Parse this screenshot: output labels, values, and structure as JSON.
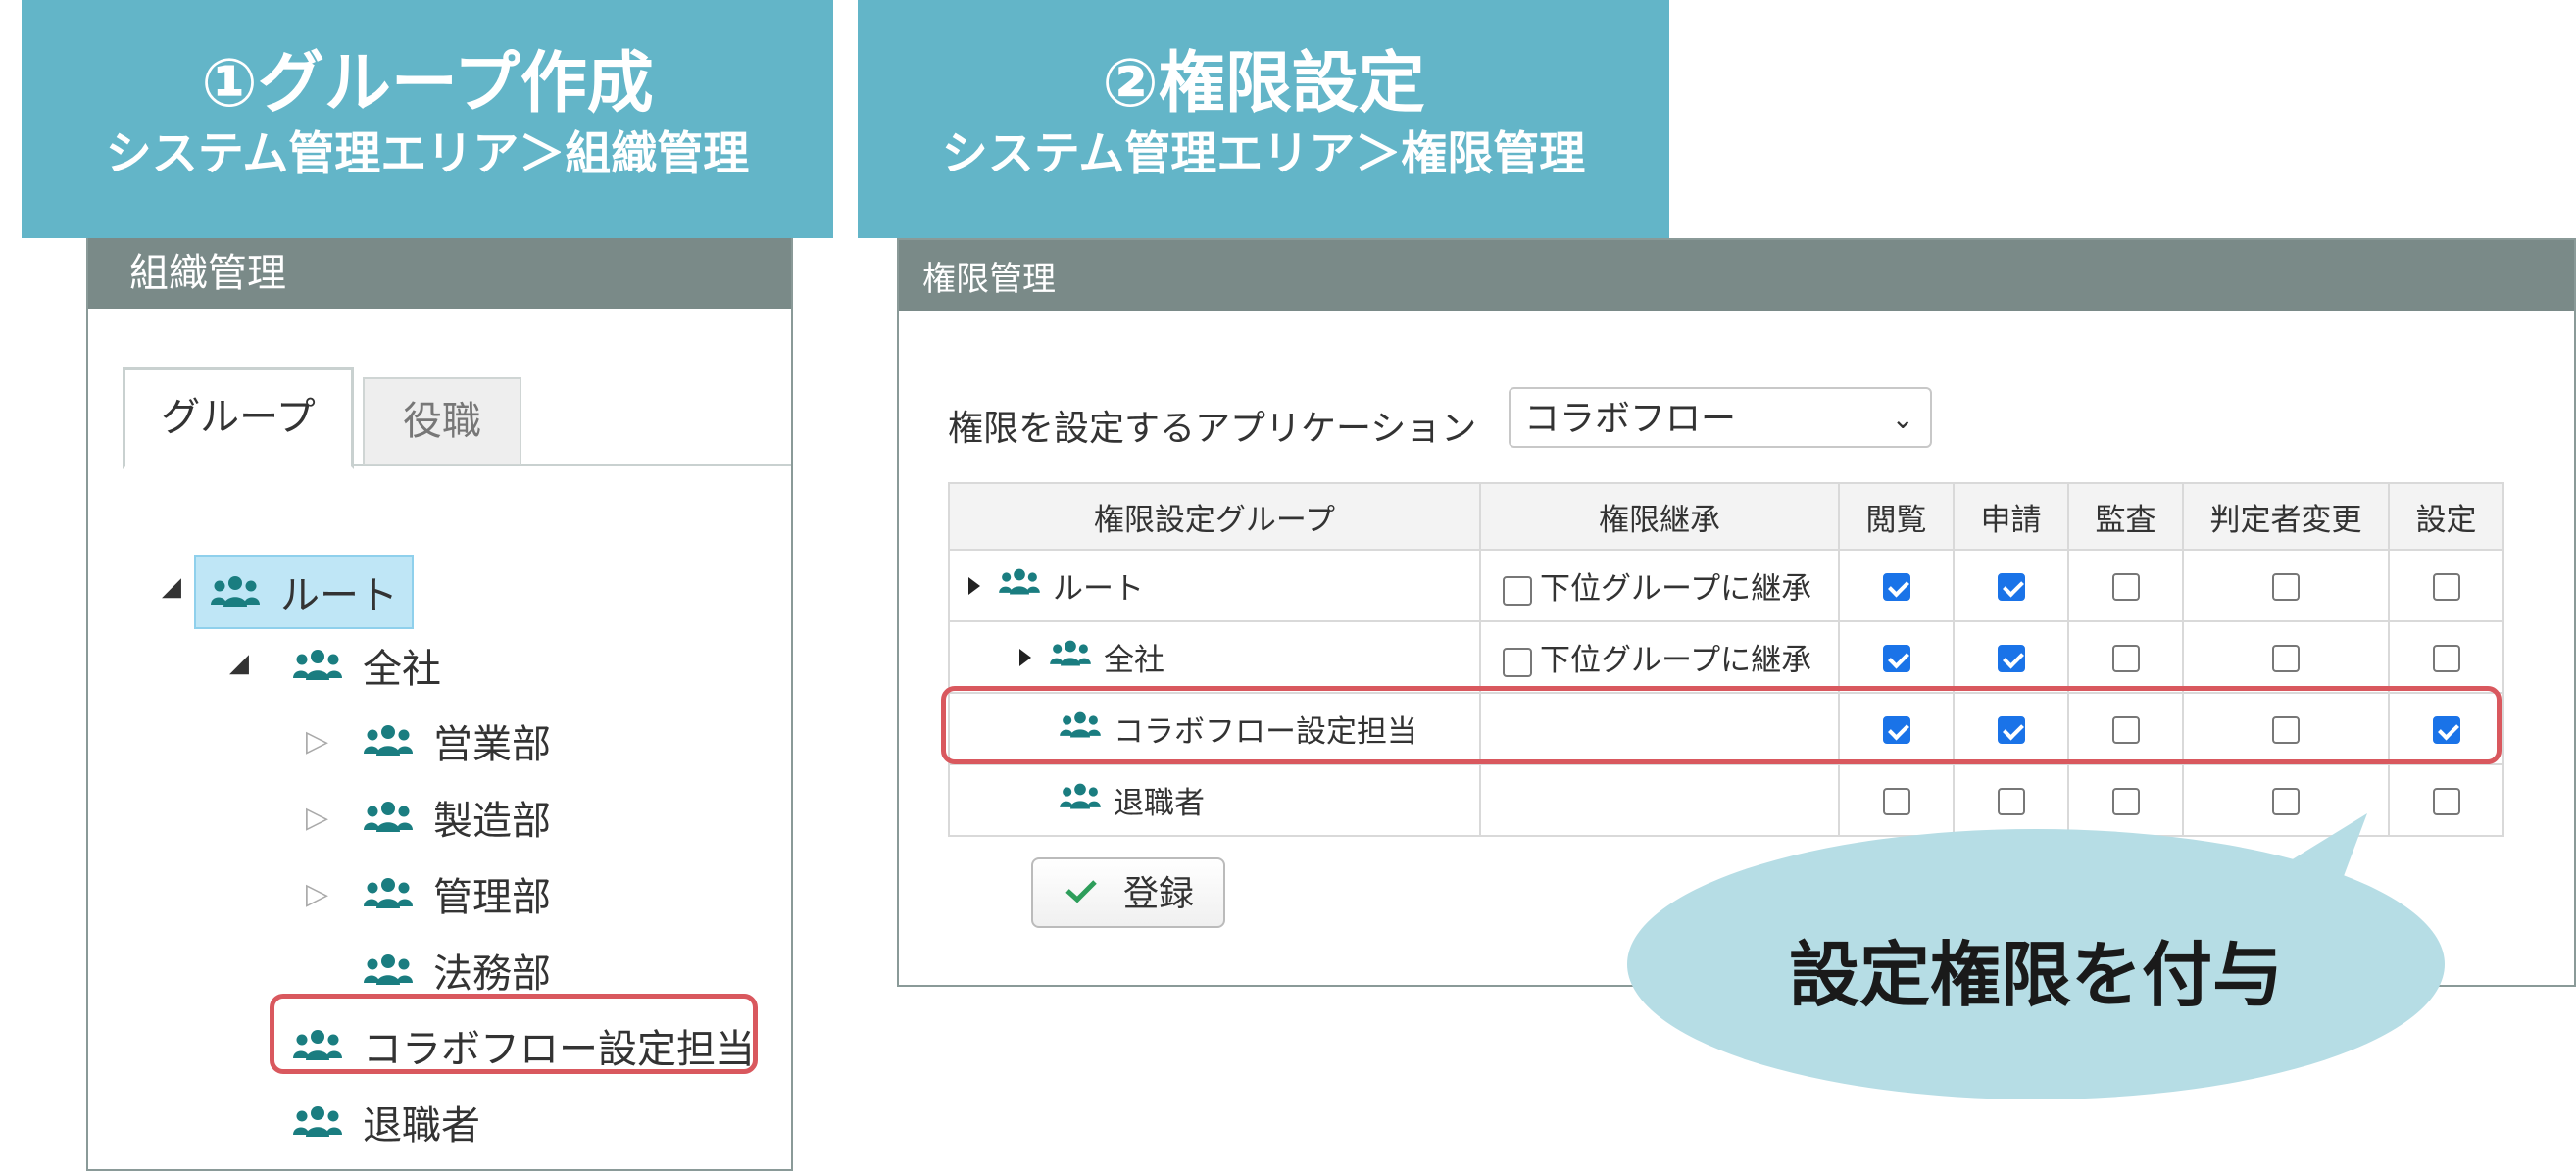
{
  "banners": [
    {
      "title": "①グループ作成",
      "subtitle": "システム管理エリア＞組織管理"
    },
    {
      "title": "②権限設定",
      "subtitle": "システム管理エリア＞権限管理"
    }
  ],
  "org_panel": {
    "title": "組織管理",
    "tabs": [
      {
        "label": "グループ",
        "active": true
      },
      {
        "label": "役職",
        "active": false
      }
    ],
    "tree": [
      {
        "label": "ルート",
        "level": 0,
        "toggle": "expanded",
        "selected": true
      },
      {
        "label": "全社",
        "level": 1,
        "toggle": "expanded"
      },
      {
        "label": "営業部",
        "level": 2,
        "toggle": "collapsed"
      },
      {
        "label": "製造部",
        "level": 2,
        "toggle": "collapsed"
      },
      {
        "label": "管理部",
        "level": 2,
        "toggle": "collapsed"
      },
      {
        "label": "法務部",
        "level": 2,
        "toggle": "none"
      },
      {
        "label": "コラボフロー設定担当",
        "level": 1,
        "toggle": "none",
        "highlighted": true
      },
      {
        "label": "退職者",
        "level": 1,
        "toggle": "none"
      }
    ]
  },
  "perm_panel": {
    "title": "権限管理",
    "app_label": "権限を設定するアプリケーション",
    "app_value": "コラボフロー",
    "columns": [
      "権限設定グループ",
      "権限継承",
      "閲覧",
      "申請",
      "監査",
      "判定者変更",
      "設定"
    ],
    "inherit_label": "下位グループに継承",
    "rows": [
      {
        "group": "ルート",
        "caret": true,
        "inherit": false,
        "show_inherit": true,
        "perms": [
          true,
          true,
          false,
          false,
          false
        ]
      },
      {
        "group": "全社",
        "caret": true,
        "inherit": false,
        "show_inherit": true,
        "perms": [
          true,
          true,
          false,
          false,
          false
        ]
      },
      {
        "group": "コラボフロー設定担当",
        "caret": false,
        "show_inherit": false,
        "perms": [
          true,
          true,
          false,
          false,
          true
        ],
        "highlighted": true
      },
      {
        "group": "退職者",
        "caret": false,
        "show_inherit": false,
        "perms": [
          false,
          false,
          false,
          false,
          false
        ]
      }
    ],
    "register_label": "登録"
  },
  "callout": {
    "text": "設定権限を付与"
  },
  "colors": {
    "banner": "#63b5c8",
    "panel_header": "#7a8a88",
    "highlight": "#d9585e",
    "bubble": "#b6dde5",
    "check": "#1a73e8",
    "icon": "#1a7d80"
  }
}
